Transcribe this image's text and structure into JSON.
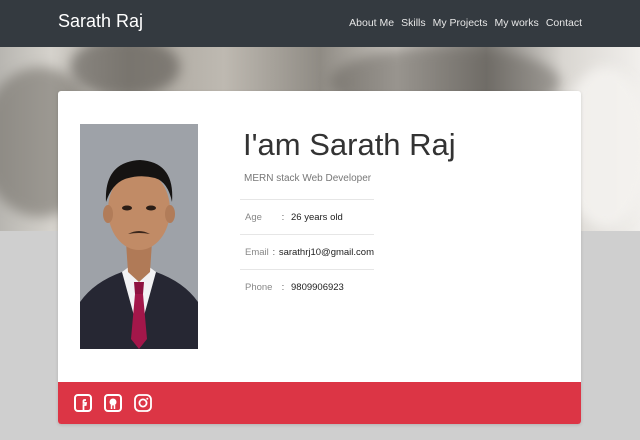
{
  "brand": "Sarath Raj",
  "nav": [
    "About Me",
    "Skills",
    "My Projects",
    "My works",
    "Contact"
  ],
  "profile": {
    "name": "I'am Sarath Raj",
    "role": "MERN stack Web Developer",
    "fields": [
      {
        "label": "Age",
        "sep": ":",
        "value": "26 years old"
      },
      {
        "label": "Email",
        "sep": ":",
        "value": "sarathrj10@gmail.com"
      },
      {
        "label": "Phone",
        "sep": ":",
        "value": "9809906923"
      }
    ]
  },
  "social": [
    "facebook-icon",
    "github-icon",
    "instagram-icon"
  ],
  "colors": {
    "navbar": "#343a40",
    "footer": "#dc3545",
    "background": "#cfcfcf"
  }
}
